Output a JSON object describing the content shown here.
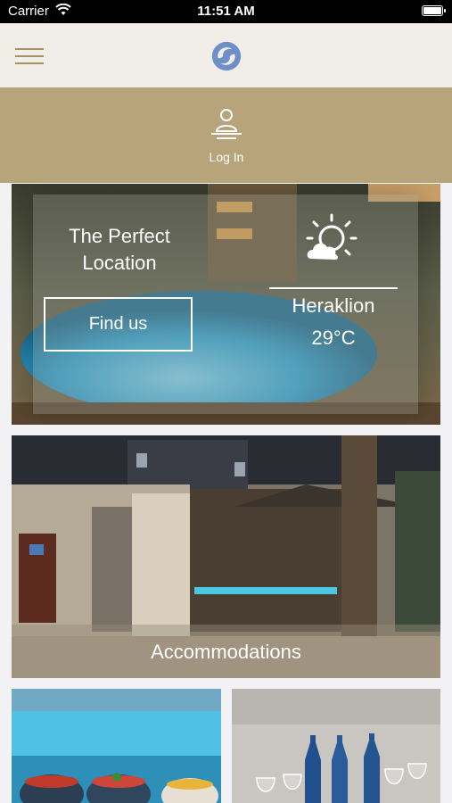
{
  "status_bar": {
    "carrier": "Carrier",
    "time": "11:51 AM",
    "icons": [
      "wifi-icon",
      "battery-icon"
    ]
  },
  "nav": {
    "menu_icon": "hamburger-menu-icon",
    "logo_icon": "swirl-logo-icon",
    "accent_color": "#a79061",
    "background": "#f1ede7"
  },
  "login": {
    "label": "Log In",
    "icon": "user-icon",
    "background": "#b8a47a"
  },
  "location_card": {
    "title_line1": "The Perfect",
    "title_line2": "Location",
    "button_label": "Find us",
    "weather_icon": "partly-cloudy-sun-icon",
    "city": "Heraklion",
    "temperature": "29°C"
  },
  "accommodations_card": {
    "label": "Accommodations"
  },
  "dining_card": {},
  "events_card": {}
}
